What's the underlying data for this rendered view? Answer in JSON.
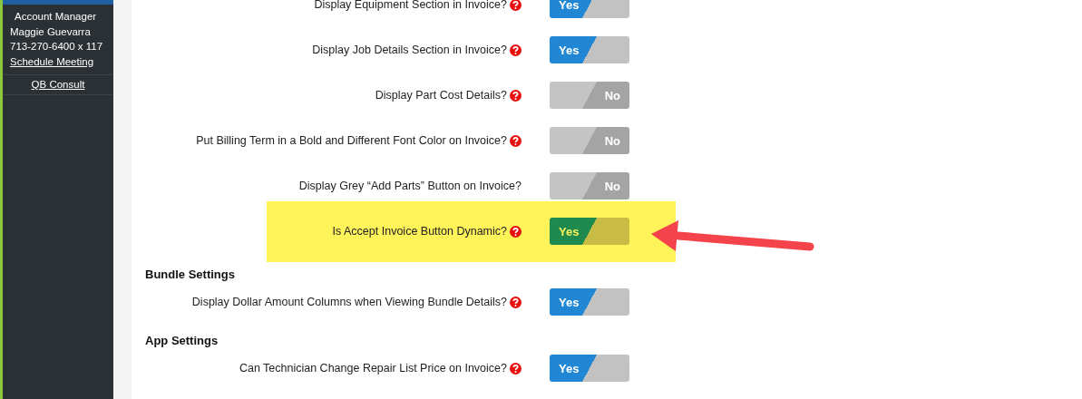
{
  "sidebar": {
    "account": {
      "role": "Account Manager",
      "name": "Maggie Guevarra",
      "phone": "713-270-6400 x 117",
      "link": "Schedule Meeting"
    },
    "links": [
      "QB Consult"
    ]
  },
  "sections": [
    {
      "settings": [
        {
          "label": "Display Equipment Section in Invoice?",
          "help": true,
          "on": true,
          "toggle_text": "Yes",
          "highlighted": false
        },
        {
          "label": "Display Job Details Section in Invoice?",
          "help": true,
          "on": true,
          "toggle_text": "Yes",
          "highlighted": false
        },
        {
          "label": "Display Part Cost Details?",
          "help": true,
          "on": false,
          "toggle_text": "No",
          "highlighted": false
        },
        {
          "label": "Put Billing Term in a Bold and Different Font Color on Invoice?",
          "help": true,
          "on": false,
          "toggle_text": "No",
          "highlighted": false
        },
        {
          "label": "Display Grey “Add Parts” Button on Invoice?",
          "help": false,
          "on": false,
          "toggle_text": "No",
          "highlighted": false
        },
        {
          "label": "Is Accept Invoice Button Dynamic?",
          "help": true,
          "on": true,
          "toggle_text": "Yes",
          "highlighted": true
        }
      ]
    },
    {
      "heading": "Bundle Settings",
      "settings": [
        {
          "label": "Display Dollar Amount Columns when Viewing Bundle Details?",
          "help": true,
          "on": true,
          "toggle_text": "Yes",
          "highlighted": false
        }
      ]
    },
    {
      "heading": "App Settings",
      "settings": [
        {
          "label": "Can Technician Change Repair List Price on Invoice?",
          "help": true,
          "on": true,
          "toggle_text": "Yes",
          "highlighted": false
        }
      ]
    }
  ]
}
